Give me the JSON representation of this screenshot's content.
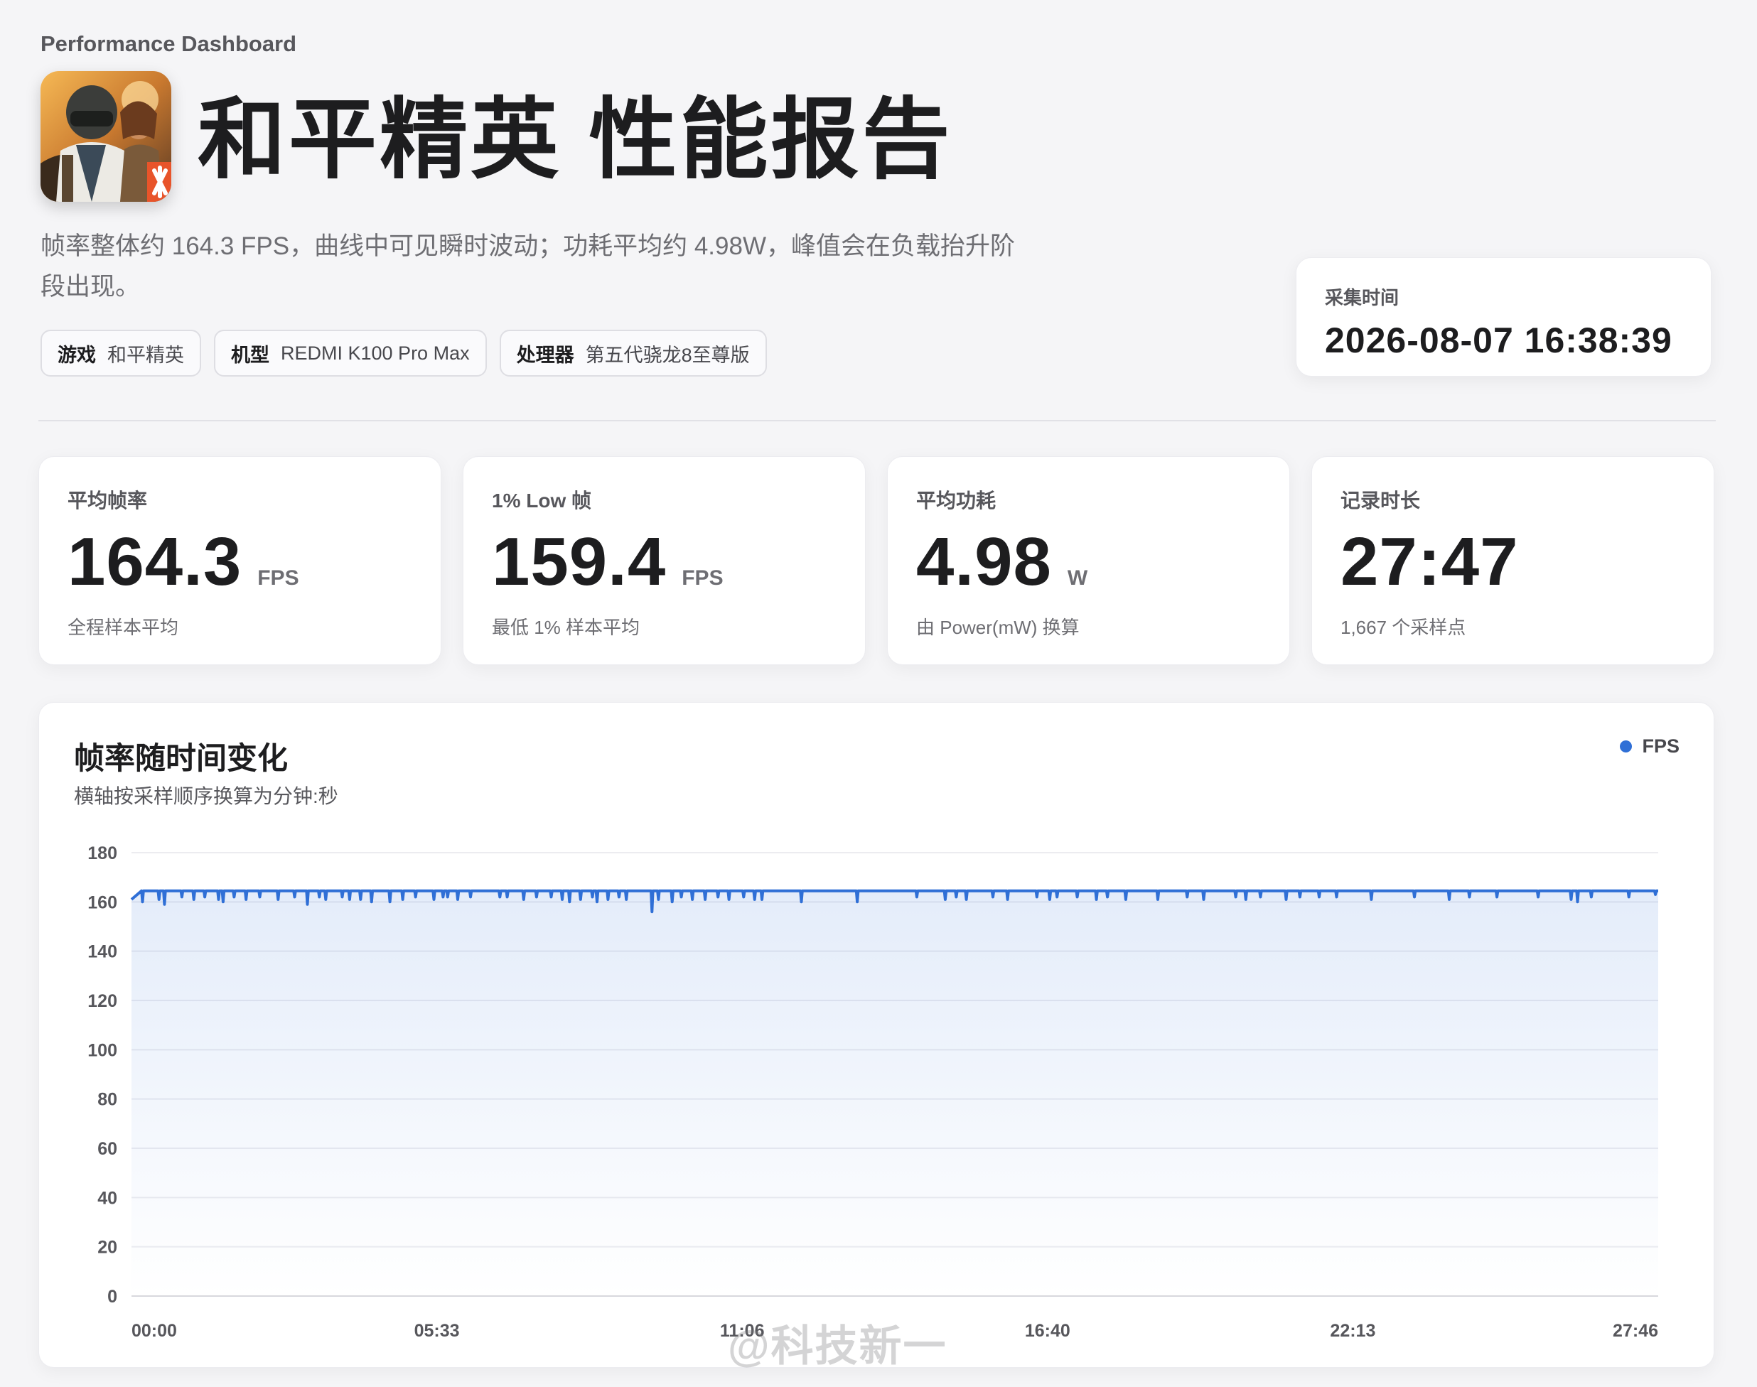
{
  "header": {
    "eyebrow": "Performance Dashboard",
    "title": "和平精英 性能报告",
    "summary": "帧率整体约 164.3 FPS，曲线中可见瞬时波动；功耗平均约 4.98W，峰值会在负载抬升阶段出现。",
    "chips": [
      {
        "key": "游戏",
        "value": "和平精英"
      },
      {
        "key": "机型",
        "value": "REDMI K100 Pro Max"
      },
      {
        "key": "处理器",
        "value": "第五代骁龙8至尊版"
      }
    ],
    "capture": {
      "label": "采集时间",
      "value": "2026-08-07 16:38:39"
    }
  },
  "stats": [
    {
      "label": "平均帧率",
      "value": "164.3",
      "unit": "FPS",
      "sub": "全程样本平均"
    },
    {
      "label": "1% Low 帧",
      "value": "159.4",
      "unit": "FPS",
      "sub": "最低 1% 样本平均"
    },
    {
      "label": "平均功耗",
      "value": "4.98",
      "unit": "W",
      "sub": "由 Power(mW) 换算"
    },
    {
      "label": "记录时长",
      "value": "27:47",
      "unit": "",
      "sub": "1,667 个采样点"
    }
  ],
  "chart": {
    "title": "帧率随时间变化",
    "subtitle": "横轴按采样顺序换算为分钟:秒",
    "legend": "FPS"
  },
  "chart_data": {
    "type": "area",
    "title": "帧率随时间变化",
    "xlabel": "",
    "ylabel": "",
    "ylim": [
      0,
      180
    ],
    "yticks": [
      0,
      20,
      40,
      60,
      80,
      100,
      120,
      140,
      160,
      180
    ],
    "xticks": [
      "00:00",
      "05:33",
      "11:06",
      "16:40",
      "22:13",
      "27:46"
    ],
    "x_range_seconds": [
      0,
      1666
    ],
    "color": "#2f6fd6",
    "grid": true,
    "legend_position": "top-right",
    "series": [
      {
        "name": "FPS",
        "baseline": 164.5,
        "dips": [
          [
            0,
            161
          ],
          [
            12,
            160
          ],
          [
            30,
            161
          ],
          [
            36,
            159
          ],
          [
            55,
            162
          ],
          [
            68,
            161
          ],
          [
            80,
            162
          ],
          [
            95,
            161
          ],
          [
            100,
            160
          ],
          [
            112,
            162
          ],
          [
            125,
            161
          ],
          [
            140,
            162
          ],
          [
            160,
            161
          ],
          [
            178,
            162
          ],
          [
            192,
            159
          ],
          [
            205,
            162
          ],
          [
            212,
            161
          ],
          [
            230,
            162
          ],
          [
            238,
            161
          ],
          [
            250,
            161
          ],
          [
            262,
            160
          ],
          [
            282,
            160
          ],
          [
            296,
            161
          ],
          [
            310,
            162
          ],
          [
            330,
            161
          ],
          [
            340,
            162
          ],
          [
            345,
            162
          ],
          [
            356,
            161
          ],
          [
            370,
            162
          ],
          [
            402,
            162
          ],
          [
            410,
            162
          ],
          [
            428,
            161
          ],
          [
            442,
            162
          ],
          [
            458,
            162
          ],
          [
            470,
            161
          ],
          [
            478,
            160
          ],
          [
            490,
            161
          ],
          [
            503,
            162
          ],
          [
            508,
            160
          ],
          [
            520,
            161
          ],
          [
            532,
            162
          ],
          [
            540,
            161
          ],
          [
            568,
            156
          ],
          [
            575,
            161
          ],
          [
            590,
            160
          ],
          [
            600,
            162
          ],
          [
            612,
            161
          ],
          [
            626,
            161
          ],
          [
            640,
            162
          ],
          [
            652,
            161
          ],
          [
            668,
            162
          ],
          [
            680,
            161
          ],
          [
            688,
            161
          ],
          [
            731,
            160
          ],
          [
            792,
            160
          ],
          [
            857,
            162
          ],
          [
            888,
            161
          ],
          [
            900,
            162
          ],
          [
            911,
            161
          ],
          [
            940,
            162
          ],
          [
            956,
            161
          ],
          [
            988,
            162
          ],
          [
            1002,
            161
          ],
          [
            1010,
            162
          ],
          [
            1032,
            162
          ],
          [
            1053,
            161
          ],
          [
            1065,
            162
          ],
          [
            1085,
            161
          ],
          [
            1120,
            161
          ],
          [
            1152,
            162
          ],
          [
            1170,
            161
          ],
          [
            1205,
            162
          ],
          [
            1216,
            161
          ],
          [
            1232,
            162
          ],
          [
            1260,
            161
          ],
          [
            1275,
            162
          ],
          [
            1296,
            162
          ],
          [
            1315,
            162
          ],
          [
            1353,
            161
          ],
          [
            1400,
            162
          ],
          [
            1438,
            161
          ],
          [
            1460,
            162
          ],
          [
            1490,
            162
          ],
          [
            1535,
            162
          ],
          [
            1571,
            161
          ],
          [
            1578,
            160
          ],
          [
            1593,
            162
          ],
          [
            1634,
            162
          ],
          [
            1663,
            163
          ]
        ]
      }
    ]
  },
  "watermark": "@科技新一"
}
